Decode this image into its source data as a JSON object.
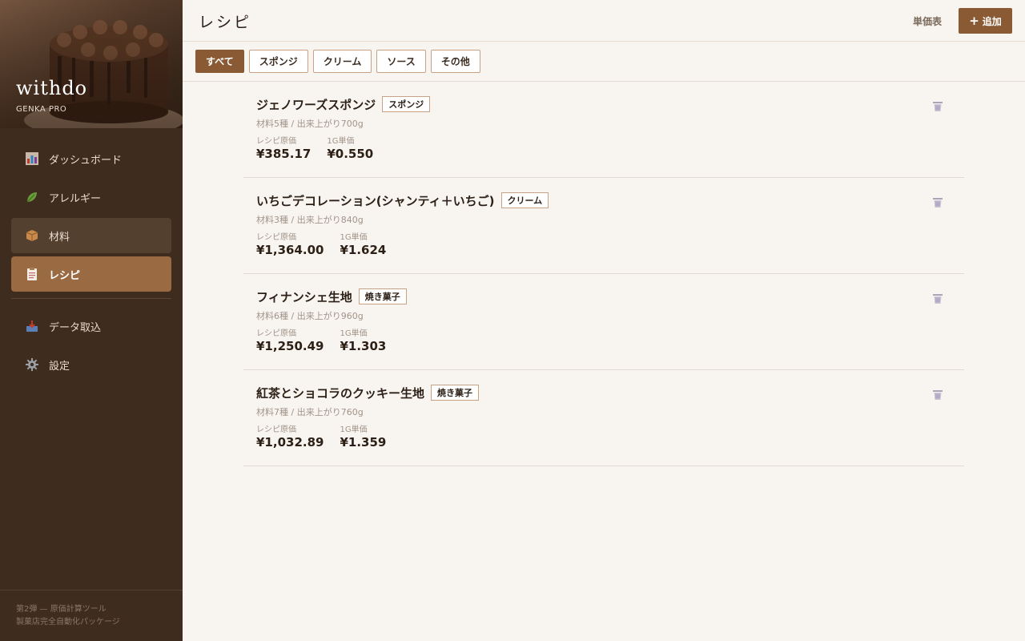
{
  "brand": {
    "title": "withdo",
    "subtitle": "GENKA PRO"
  },
  "nav": {
    "items": [
      {
        "label": "ダッシュボード",
        "icon": "bar-chart-icon"
      },
      {
        "label": "アレルギー",
        "icon": "leaf-icon"
      },
      {
        "label": "材料",
        "icon": "box-icon"
      },
      {
        "label": "レシピ",
        "icon": "clipboard-icon"
      }
    ],
    "secondary": [
      {
        "label": "データ取込",
        "icon": "inbox-tray-icon"
      },
      {
        "label": "設定",
        "icon": "gear-icon"
      }
    ]
  },
  "footer": {
    "line1": "第2弾 — 原価計算ツール",
    "line2": "製菓店完全自動化パッケージ"
  },
  "header": {
    "title": "レシピ",
    "price_table": "単価表",
    "add_label": "追加",
    "add_icon": "+"
  },
  "filters": [
    "すべて",
    "スポンジ",
    "クリーム",
    "ソース",
    "その他"
  ],
  "stat_labels": {
    "cost": "レシピ原価",
    "unit": "1G単価"
  },
  "recipes": [
    {
      "name": "ジェノワーズスポンジ",
      "category": "スポンジ",
      "meta": "材料5種 / 出来上がり700g",
      "cost": "¥385.17",
      "unit": "¥0.550"
    },
    {
      "name": "いちごデコレーション(シャンティ＋いちご)",
      "category": "クリーム",
      "meta": "材料3種 / 出来上がり840g",
      "cost": "¥1,364.00",
      "unit": "¥1.624"
    },
    {
      "name": "フィナンシェ生地",
      "category": "焼き菓子",
      "meta": "材料6種 / 出来上がり960g",
      "cost": "¥1,250.49",
      "unit": "¥1.303"
    },
    {
      "name": "紅茶とショコラのクッキー生地",
      "category": "焼き菓子",
      "meta": "材料7種 / 出来上がり760g",
      "cost": "¥1,032.89",
      "unit": "¥1.359"
    }
  ],
  "colors": {
    "sidebar": "#3e2c1e",
    "accent": "#8a5a34",
    "active_nav": "#9a6a42",
    "background": "#f8f4ef"
  }
}
